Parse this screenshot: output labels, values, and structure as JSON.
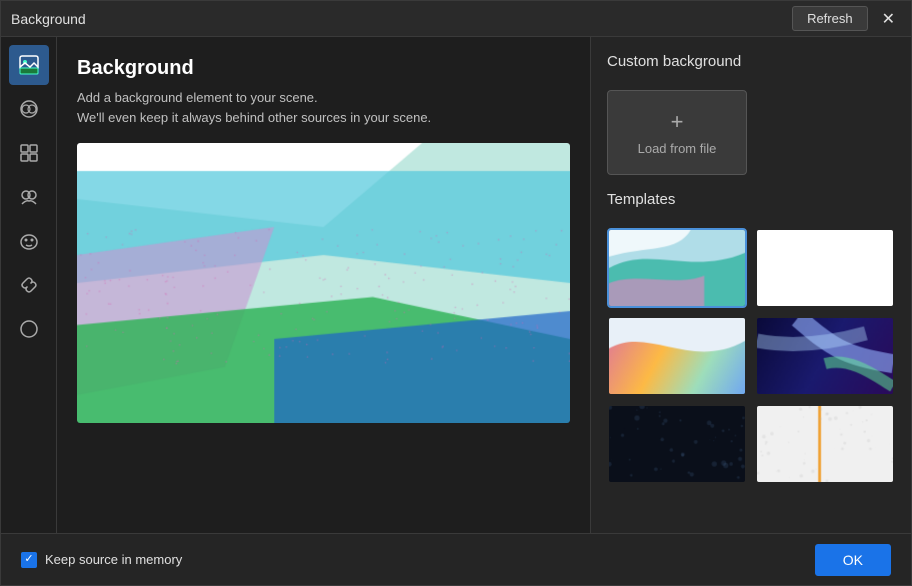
{
  "window": {
    "title": "Background"
  },
  "toolbar": {
    "refresh_label": "Refresh",
    "close_label": "✕"
  },
  "sidebar": {
    "icons": [
      {
        "name": "image-icon",
        "symbol": "🖼",
        "active": true
      },
      {
        "name": "filter-icon",
        "symbol": "⊙",
        "active": false
      },
      {
        "name": "layout-icon",
        "symbol": "⊞",
        "active": false
      },
      {
        "name": "group-icon",
        "symbol": "👥",
        "active": false
      },
      {
        "name": "mask-icon",
        "symbol": "😶",
        "active": false
      },
      {
        "name": "link-icon",
        "symbol": "🔗",
        "active": false
      },
      {
        "name": "theme-icon",
        "symbol": "◑",
        "active": false
      }
    ]
  },
  "center": {
    "title": "Background",
    "description_line1": "Add a background element to your scene.",
    "description_line2": "We'll even keep it always behind other sources in your scene."
  },
  "right_panel": {
    "custom_background_label": "Custom background",
    "load_from_file_label": "Load from file",
    "templates_label": "Templates"
  },
  "bottom": {
    "checkbox_label": "Keep source in memory",
    "ok_label": "OK"
  },
  "colors": {
    "accent": "#1a73e8"
  }
}
